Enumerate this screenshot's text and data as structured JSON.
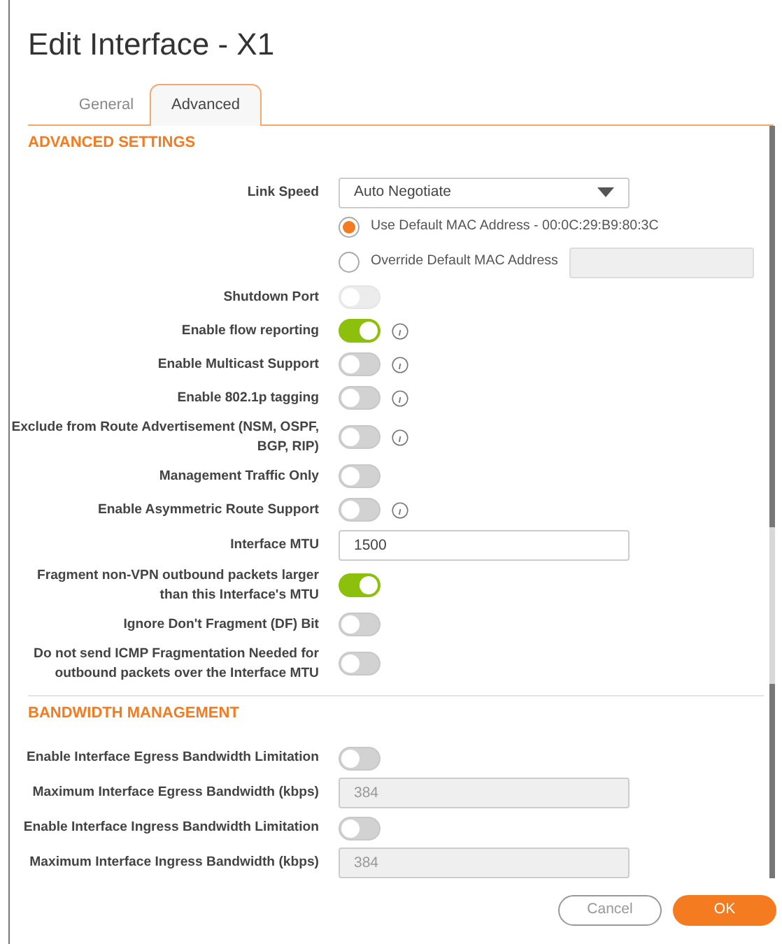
{
  "title": "Edit Interface - X1",
  "tabs": [
    {
      "label": "General",
      "selected": false
    },
    {
      "label": "Advanced",
      "selected": true
    }
  ],
  "sections": [
    {
      "title": "ADVANCED SETTINGS",
      "rows": [
        {
          "kind": "select",
          "label": "Link Speed",
          "value": "Auto Negotiate"
        },
        {
          "kind": "radio",
          "text": "Use Default MAC Address  - 00:0C:29:B9:80:3C",
          "selected": true,
          "field": false
        },
        {
          "kind": "radio",
          "text": "Override Default MAC Address",
          "selected": false,
          "field": true
        },
        {
          "kind": "toggle",
          "label": "Shutdown Port",
          "on": false,
          "disabled": true,
          "info": false
        },
        {
          "kind": "toggle",
          "label": "Enable flow reporting",
          "on": true,
          "disabled": false,
          "info": true
        },
        {
          "kind": "toggle",
          "label": "Enable Multicast Support",
          "on": false,
          "disabled": false,
          "info": true
        },
        {
          "kind": "toggle",
          "label": "Enable 802.1p tagging",
          "on": false,
          "disabled": false,
          "info": true
        },
        {
          "kind": "toggle",
          "label": "Exclude from Route Advertisement (NSM, OSPF, BGP, RIP)",
          "on": false,
          "disabled": false,
          "info": true
        },
        {
          "kind": "toggle",
          "label": "Management Traffic Only",
          "on": false,
          "disabled": false,
          "info": false
        },
        {
          "kind": "toggle",
          "label": "Enable Asymmetric Route Support",
          "on": false,
          "disabled": false,
          "info": true
        },
        {
          "kind": "input",
          "label": "Interface MTU",
          "value": "1500",
          "disabled": false
        },
        {
          "kind": "toggle",
          "label": "Fragment non-VPN outbound packets larger than this Interface's MTU",
          "on": true,
          "disabled": false,
          "info": false
        },
        {
          "kind": "toggle",
          "label": "Ignore Don't Fragment (DF) Bit",
          "on": false,
          "disabled": false,
          "info": false
        },
        {
          "kind": "toggle",
          "label": "Do not send ICMP Fragmentation Needed for outbound packets over the Interface MTU",
          "on": false,
          "disabled": false,
          "info": false
        }
      ]
    },
    {
      "title": "BANDWIDTH MANAGEMENT",
      "rows": [
        {
          "kind": "toggle",
          "label": "Enable Interface Egress Bandwidth Limitation",
          "on": false,
          "disabled": false,
          "info": false
        },
        {
          "kind": "input",
          "label": "Maximum Interface Egress Bandwidth (kbps)",
          "value": "384",
          "disabled": true
        },
        {
          "kind": "toggle",
          "label": "Enable Interface Ingress Bandwidth Limitation",
          "on": false,
          "disabled": false,
          "info": false
        },
        {
          "kind": "input",
          "label": "Maximum Interface Ingress Bandwidth (kbps)",
          "value": "384",
          "disabled": true
        }
      ]
    }
  ],
  "buttons": [
    {
      "label": "Cancel",
      "kind": "secondary"
    },
    {
      "label": "OK",
      "kind": "primary"
    }
  ]
}
